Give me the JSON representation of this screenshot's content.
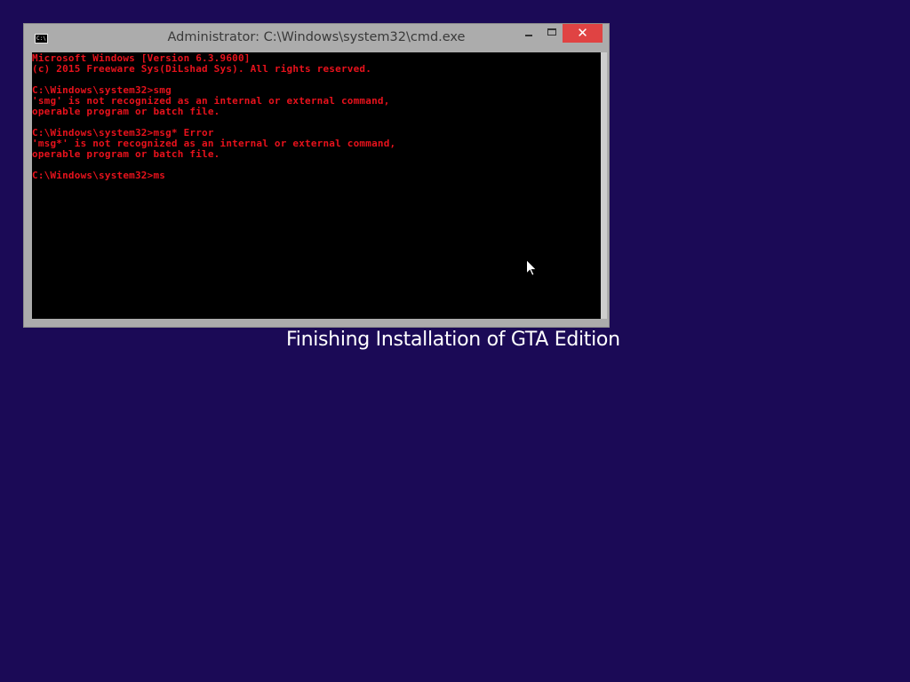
{
  "colors": {
    "desktop_background": "#1b0a56",
    "console_background": "#000000",
    "console_text": "#e8121c",
    "window_frame": "#acacac",
    "close_button": "#e04343"
  },
  "window": {
    "icon": "cmd-app-icon",
    "icon_text": "C:\\",
    "title": "Administrator: C:\\Windows\\system32\\cmd.exe",
    "controls": {
      "minimize_icon": "minimize-icon",
      "maximize_icon": "maximize-icon",
      "close_icon": "close-icon",
      "close_glyph": "✕"
    }
  },
  "console": {
    "lines": [
      "Microsoft Windows [Version 6.3.9600]",
      "(c) 2015 Freeware Sys(DiLshad Sys). All rights reserved.",
      "",
      "C:\\Windows\\system32>smg",
      "'smg' is not recognized as an internal or external command,",
      "operable program or batch file.",
      "",
      "C:\\Windows\\system32>msg* Error",
      "'msg*' is not recognized as an internal or external command,",
      "operable program or batch file.",
      "",
      "C:\\Windows\\system32>ms"
    ]
  },
  "caption": "Finishing Installation of GTA Edition",
  "cursor_icon": "mouse-pointer-icon"
}
